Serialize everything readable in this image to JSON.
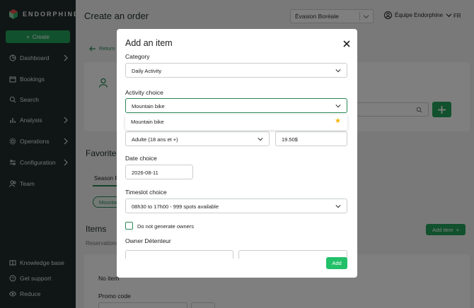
{
  "sidebar": {
    "brand": "ENDORPHINE",
    "create_label": "Create",
    "items": [
      {
        "label": "Dashboard",
        "icon": "pie-chart-icon",
        "has_chevron": true
      },
      {
        "label": "Bookings",
        "icon": "calendar-icon",
        "has_chevron": false
      },
      {
        "label": "Search",
        "icon": "search-icon",
        "has_chevron": false
      },
      {
        "label": "Analysis",
        "icon": "bar-chart-icon",
        "has_chevron": true
      },
      {
        "label": "Operations",
        "icon": "gear-icon",
        "has_chevron": true
      },
      {
        "label": "Configuration",
        "icon": "sliders-icon",
        "has_chevron": true
      },
      {
        "label": "Team",
        "icon": "users-icon",
        "has_chevron": false
      }
    ],
    "bottom_items": [
      {
        "label": "Knowledge base",
        "icon": "book-icon"
      },
      {
        "label": "Get support",
        "icon": "help-icon"
      },
      {
        "label": "Reduce",
        "icon": "eye-icon"
      }
    ]
  },
  "header": {
    "title": "Create an order",
    "org_select": "Évasion Boréale",
    "user": "Équipe Endorphine",
    "lang": "FR"
  },
  "background": {
    "back_label": "Return",
    "favorites_title": "Favorites",
    "tab_label": "Season P",
    "chip_label": "Mountain",
    "items_title": "Items",
    "reservations_label": "Reservations",
    "add_item_label": "Add item",
    "no_item": "No item",
    "promo_label": "Promo code"
  },
  "modal": {
    "title": "Add an item",
    "category_label": "Category",
    "category_value": "Daily Activity",
    "activity_label": "Activity choice",
    "activity_value": "Mountain bike",
    "dropdown_option": "Mountain bike",
    "rate_value": "Adulte (18 ans et +)",
    "price_value": "19.50$",
    "date_label": "Date choice",
    "date_value": "2026-08-11",
    "timeslot_label": "Timeslot choice",
    "timeslot_value": "08h30 to 17h00 - 999 spots available",
    "no_owners_label": "Do not generate owners",
    "owner_label": "Owner Détenteur",
    "add_label": "Add"
  },
  "colors": {
    "sidebar_bg": "#1f2d2a",
    "accent": "#22a35a",
    "star": "#f5b301"
  }
}
